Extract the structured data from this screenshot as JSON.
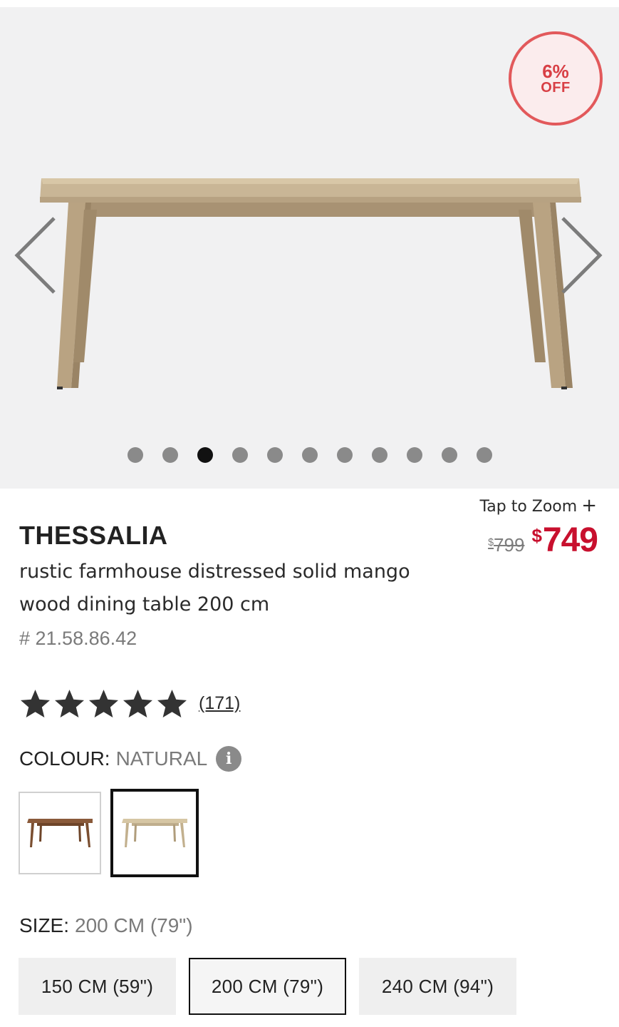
{
  "gallery": {
    "badge_percent": "6%",
    "badge_off": "OFF",
    "dots_count": 11,
    "active_dot_index": 2,
    "prev_icon": "chevron-left-icon",
    "next_icon": "chevron-right-icon"
  },
  "zoom": {
    "label": "Tap to Zoom",
    "icon": "+"
  },
  "price": {
    "old_currency": "$",
    "old_amount": "799",
    "new_currency": "$",
    "new_amount": "749",
    "sale_color": "#c8102e"
  },
  "product": {
    "brand": "THESSALIA",
    "description": "rustic farmhouse distressed solid mango wood dining table 200 cm",
    "sku": "# 21.58.86.42"
  },
  "rating": {
    "stars": 5,
    "reviews": "(171)"
  },
  "colour": {
    "label": "COLOUR:",
    "value": "NATURAL",
    "info_icon": "i",
    "swatches": [
      {
        "name": "walnut",
        "selected": false
      },
      {
        "name": "natural",
        "selected": true
      }
    ]
  },
  "size": {
    "label": "SIZE:",
    "value": "200 CM (79\")",
    "options": [
      "150 CM (59\")",
      "200 CM (79\")",
      "240 CM (94\")"
    ],
    "selected_index": 1
  }
}
